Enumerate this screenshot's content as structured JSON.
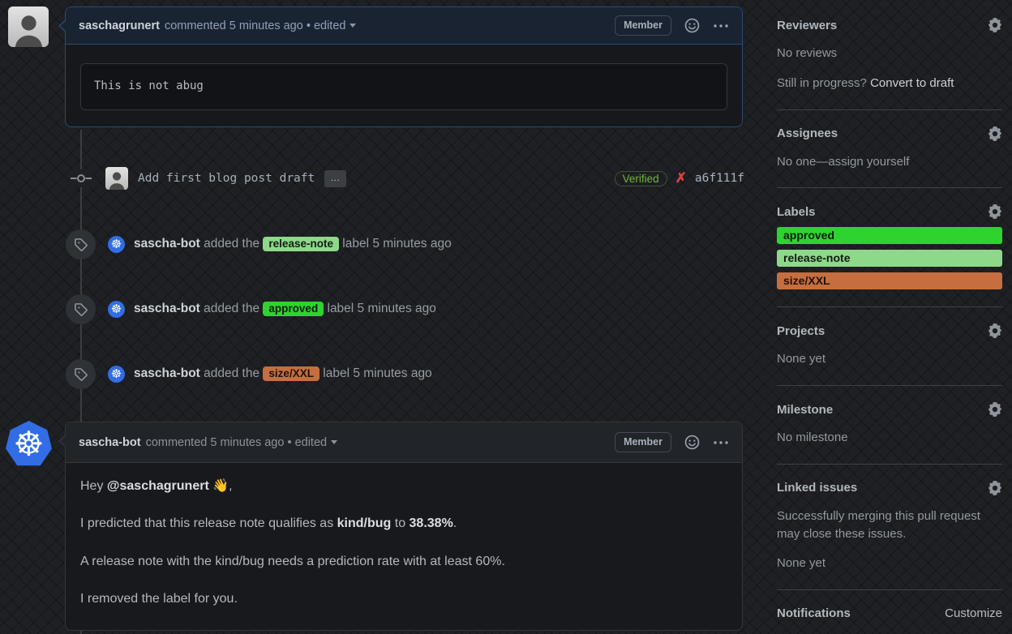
{
  "icons": {
    "kubernetes_glyph": "☸"
  },
  "comment1": {
    "author": "saschagrunert",
    "action": "commented 5 minutes ago",
    "edited": "• edited",
    "member_badge": "Member",
    "code": "This is not abug"
  },
  "commit": {
    "message": "Add first blog post draft",
    "expand": "…",
    "verified_badge": "Verified",
    "status_x": "✗",
    "sha": "a6f111f"
  },
  "events": [
    {
      "actor": "sascha-bot",
      "middle": " added the ",
      "label": "release-note",
      "tail": " label 5 minutes ago",
      "bg": "#8ed88a",
      "fg": "#131a12"
    },
    {
      "actor": "sascha-bot",
      "middle": " added the ",
      "label": "approved",
      "tail": " label 5 minutes ago",
      "bg": "#2fd32f",
      "fg": "#0c1a0c"
    },
    {
      "actor": "sascha-bot",
      "middle": " added the ",
      "label": "size/XXL",
      "tail": " label 5 minutes ago",
      "bg": "#c66e3f",
      "fg": "#221007"
    }
  ],
  "comment2": {
    "author": "sascha-bot",
    "action": "commented 5 minutes ago",
    "edited": "• edited",
    "member_badge": "Member",
    "p1_pre": "Hey ",
    "mention": "@saschagrunert",
    "wave": " 👋",
    "p1_post": ",",
    "p2_a": "I predicted that this release note qualifies as ",
    "p2_b": "kind/bug",
    "p2_c": " to ",
    "p2_d": "38.38%",
    "p2_e": ".",
    "p3": "A release note with the kind/bug needs a prediction rate with at least 60%.",
    "p4": "I removed the label for you."
  },
  "sidebar": {
    "reviewers": {
      "title": "Reviewers",
      "empty": "No reviews",
      "question": "Still in progress? ",
      "link": "Convert to draft"
    },
    "assignees": {
      "title": "Assignees",
      "empty": "No one—assign yourself"
    },
    "labels": {
      "title": "Labels",
      "items": [
        {
          "name": "approved",
          "bg": "#2fd32f",
          "fg": "#0c1a0c"
        },
        {
          "name": "release-note",
          "bg": "#8ed88a",
          "fg": "#131a12"
        },
        {
          "name": "size/XXL",
          "bg": "#c66e3f",
          "fg": "#221007"
        }
      ]
    },
    "projects": {
      "title": "Projects",
      "empty": "None yet"
    },
    "milestone": {
      "title": "Milestone",
      "empty": "No milestone"
    },
    "linked_issues": {
      "title": "Linked issues",
      "desc": "Successfully merging this pull request may close these issues.",
      "empty": "None yet"
    },
    "notifications": {
      "title": "Notifications",
      "action": "Customize"
    }
  }
}
